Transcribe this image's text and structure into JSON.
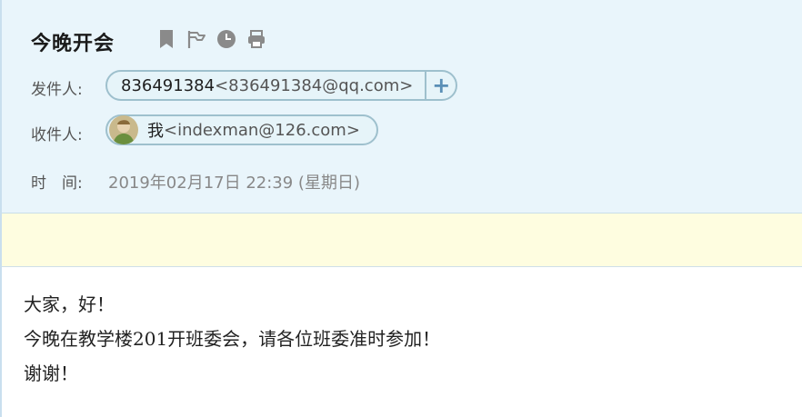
{
  "mail": {
    "subject": "今晚开会",
    "toolbar_icons": [
      "bookmark-icon",
      "flag-icon",
      "clock-icon",
      "print-icon"
    ],
    "sender": {
      "label": "发件人:",
      "name": "836491384",
      "address": "<836491384@qq.com>",
      "add_button": "+"
    },
    "recipient": {
      "label": "收件人:",
      "name": "我",
      "address": "<indexman@126.com>"
    },
    "time": {
      "label": "时　间:",
      "value": "2019年02月17日 22:39 (星期日)"
    },
    "body_lines": [
      "大家，好！",
      "今晚在教学楼201开班委会，请各位班委准时参加！",
      "谢谢！"
    ]
  },
  "colors": {
    "header_bg": "#e9f5fb",
    "notice_bg": "#fefde0",
    "pill_border": "#9ec0cd",
    "icon_gray": "#8a8a8a"
  }
}
